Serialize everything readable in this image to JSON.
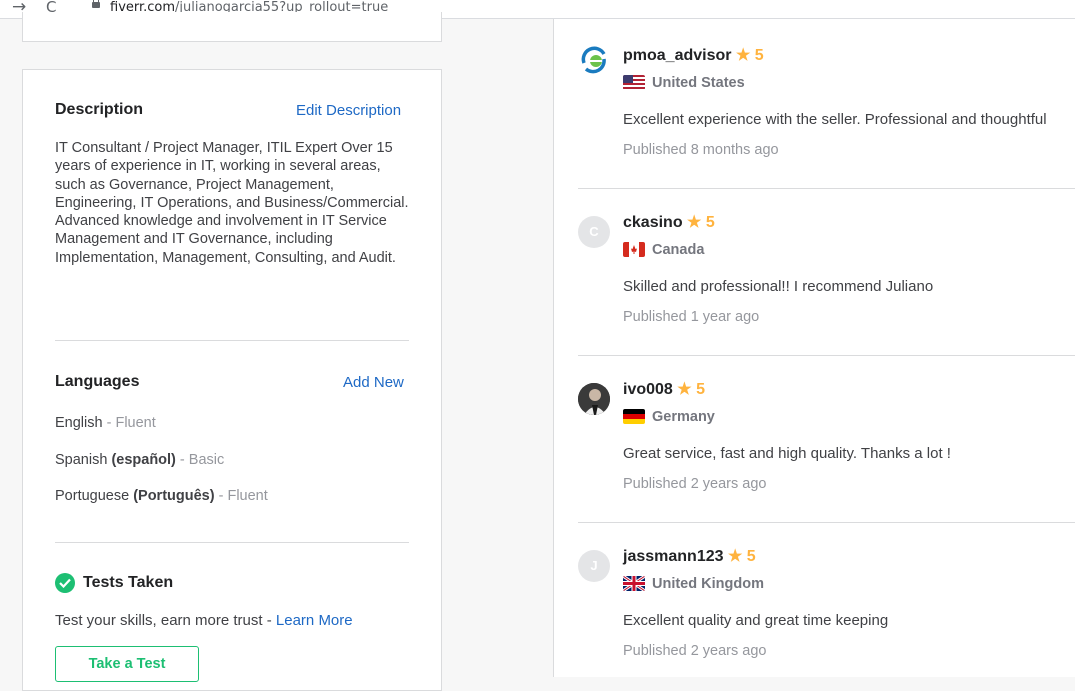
{
  "browser": {
    "back": "→",
    "reload": "C",
    "url_domain": "fiverr.com",
    "url_path": "/julianogarcia55?up_rollout=true"
  },
  "description": {
    "title": "Description",
    "edit_link": "Edit Description",
    "text": "IT Consultant / Project Manager, ITIL Expert Over 15 years of experience in IT, working in several areas, such as Governance, Project Management, Engineering, IT Operations, and Business/Commercial. Advanced knowledge and involvement in IT Service Management and IT Governance, including Implementation, Management, Consulting, and Audit."
  },
  "languages": {
    "title": "Languages",
    "add_link": "Add New",
    "items": [
      {
        "name": "English",
        "native": "",
        "level": "Fluent"
      },
      {
        "name": "Spanish",
        "native": "(español)",
        "level": "Basic"
      },
      {
        "name": "Portuguese",
        "native": "(Português)",
        "level": "Fluent"
      }
    ],
    "separator": "-"
  },
  "tests": {
    "title": "Tests Taken",
    "text": "Test your skills, earn more trust - ",
    "learn_more": "Learn More",
    "button": "Take a Test",
    "icon": "check-badge-icon"
  },
  "reviews": [
    {
      "username": "pmoa_advisor",
      "rating": "5",
      "country": "United States",
      "flag": "us",
      "text": "Excellent experience with the seller. Professional and thoughtful",
      "published": "Published 8 months ago",
      "avatar": "logo",
      "avatar_letter": ""
    },
    {
      "username": "ckasino",
      "rating": "5",
      "country": "Canada",
      "flag": "ca",
      "text": "Skilled and professional!! I recommend Juliano",
      "published": "Published 1 year ago",
      "avatar": "letter",
      "avatar_letter": "C"
    },
    {
      "username": "ivo008",
      "rating": "5",
      "country": "Germany",
      "flag": "de",
      "text": "Great service, fast and high quality. Thanks a lot !",
      "published": "Published 2 years ago",
      "avatar": "photo",
      "avatar_letter": ""
    },
    {
      "username": "jassmann123",
      "rating": "5",
      "country": "United Kingdom",
      "flag": "gb",
      "text": "Excellent quality and great time keeping",
      "published": "Published 2 years ago",
      "avatar": "letter",
      "avatar_letter": "J"
    }
  ],
  "colors": {
    "accent_green": "#1dbf73",
    "link_blue": "#1e69c5",
    "star": "#ffb33e"
  }
}
